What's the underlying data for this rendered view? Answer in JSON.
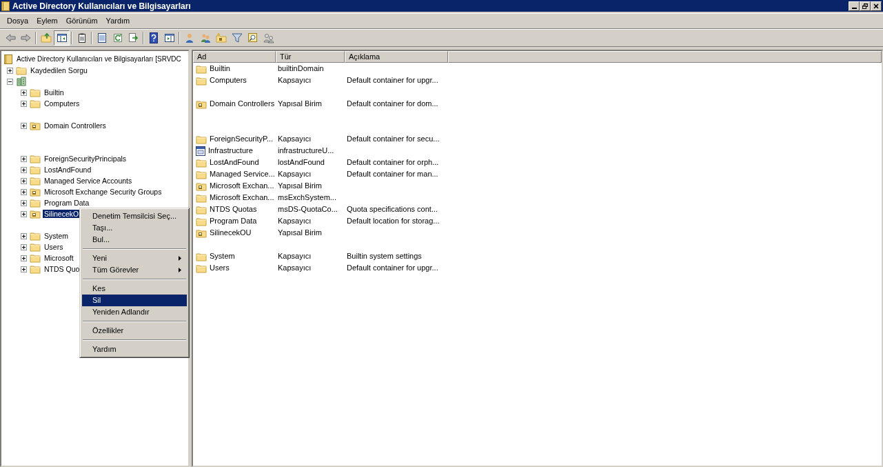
{
  "window": {
    "title": "Active Directory Kullanıcıları ve Bilgisayarları"
  },
  "menu": [
    "Dosya",
    "Eylem",
    "Görünüm",
    "Yardım"
  ],
  "toolbar": [
    {
      "pressed": false
    },
    {
      "pressed": false
    },
    {
      "pressed": false
    },
    {
      "pressed": true
    },
    {
      "pressed": false
    },
    {
      "pressed": false
    },
    {
      "pressed": false
    },
    {
      "pressed": false
    },
    {
      "pressed": false
    },
    {
      "pressed": false
    },
    {
      "pressed": false
    },
    {
      "pressed": false
    },
    {
      "pressed": false
    },
    {
      "pressed": false
    },
    {
      "pressed": false
    },
    {
      "pressed": false
    }
  ],
  "tree": {
    "label": "Active Directory Kullanıcıları ve Bilgisayarları [SRVDC",
    "kind": "root",
    "children": [
      {
        "label": "Kaydedilen Sorgu",
        "kind": "folder",
        "expanded": false,
        "selected": false
      },
      {
        "kind": "domain",
        "expanded": true,
        "children": [
          {
            "label": "Builtin",
            "kind": "folder",
            "expanded": false,
            "selected": false
          },
          {
            "label": "Computers",
            "kind": "folder",
            "expanded": false,
            "selected": false
          },
          {
            "kind": "blank"
          },
          {
            "label": "Domain Controllers",
            "kind": "ou",
            "expanded": false,
            "selected": false
          },
          {
            "kind": "blank"
          },
          {
            "kind": "blank"
          },
          {
            "label": "ForeignSecurityPrincipals",
            "kind": "folder",
            "expanded": false,
            "selected": false
          },
          {
            "label": "LostAndFound",
            "kind": "folder",
            "expanded": false,
            "selected": false
          },
          {
            "label": "Managed Service Accounts",
            "kind": "folder",
            "expanded": false,
            "selected": false
          },
          {
            "label": "Microsoft Exchange Security Groups",
            "kind": "ou",
            "expanded": false,
            "selected": false
          },
          {
            "label": "Program Data",
            "kind": "folder",
            "expanded": false,
            "selected": false
          },
          {
            "label": "SilinecekO",
            "kind": "ou",
            "expanded": false,
            "selected": true
          },
          {
            "kind": "blank"
          },
          {
            "label": "System",
            "kind": "folder",
            "expanded": false,
            "selected": false
          },
          {
            "label": "Users",
            "kind": "folder",
            "expanded": false,
            "selected": false
          },
          {
            "label": "Microsoft",
            "kind": "folder",
            "expanded": false,
            "selected": false
          },
          {
            "label": "NTDS Quo",
            "kind": "folder",
            "expanded": false,
            "selected": false
          }
        ]
      }
    ]
  },
  "list": {
    "columns": [
      "Ad",
      "Tür",
      "Açıklama"
    ],
    "rows": [
      {
        "kind": "folder",
        "name": "Builtin",
        "type": "builtinDomain"
      },
      {
        "kind": "folder",
        "name": "Computers",
        "type": "Kapsayıcı",
        "description": "Default container for upgr..."
      },
      {
        "kind": "blank"
      },
      {
        "kind": "ou",
        "name": "Domain Controllers",
        "type": "Yapısal Birim",
        "description": "Default container for dom..."
      },
      {
        "kind": "blank"
      },
      {
        "kind": "blank"
      },
      {
        "kind": "folder",
        "name": "ForeignSecurityP...",
        "type": "Kapsayıcı",
        "description": "Default container for secu..."
      },
      {
        "kind": "infra",
        "name": "Infrastructure",
        "type": "infrastructureU..."
      },
      {
        "kind": "folder",
        "name": "LostAndFound",
        "type": "lostAndFound",
        "description": "Default container for orph..."
      },
      {
        "kind": "folder",
        "name": "Managed Service...",
        "type": "Kapsayıcı",
        "description": "Default container for man..."
      },
      {
        "kind": "ou",
        "name": "Microsoft Exchan...",
        "type": "Yapısal Birim"
      },
      {
        "kind": "folder",
        "name": "Microsoft Exchan...",
        "type": "msExchSystem..."
      },
      {
        "kind": "folder",
        "name": "NTDS Quotas",
        "type": "msDS-QuotaCo...",
        "description": "Quota specifications cont..."
      },
      {
        "kind": "folder",
        "name": "Program Data",
        "type": "Kapsayıcı",
        "description": "Default location for storag..."
      },
      {
        "kind": "ou",
        "name": "SilinecekOU",
        "type": "Yapısal Birim"
      },
      {
        "kind": "blank"
      },
      {
        "kind": "folder",
        "name": "System",
        "type": "Kapsayıcı",
        "description": "Builtin system settings"
      },
      {
        "kind": "folder",
        "name": "Users",
        "type": "Kapsayıcı",
        "description": "Default container for upgr..."
      }
    ]
  },
  "context_menu": [
    {
      "kind": "item",
      "label": "Denetim Temsilcisi Seç...",
      "selected": false
    },
    {
      "kind": "item",
      "label": "Taşı...",
      "selected": false
    },
    {
      "kind": "item",
      "label": "Bul...",
      "selected": false
    },
    {
      "kind": "separator"
    },
    {
      "kind": "submenu",
      "label": "Yeni",
      "selected": false
    },
    {
      "kind": "submenu",
      "label": "Tüm Görevler",
      "selected": false
    },
    {
      "kind": "separator"
    },
    {
      "kind": "item",
      "label": "Kes",
      "selected": false
    },
    {
      "kind": "item",
      "label": "Sil",
      "selected": true
    },
    {
      "kind": "item",
      "label": "Yeniden Adlandır",
      "selected": false
    },
    {
      "kind": "separator"
    },
    {
      "kind": "item",
      "label": "Özellikler",
      "selected": false
    },
    {
      "kind": "separator"
    },
    {
      "kind": "item",
      "label": "Yardım",
      "selected": false
    }
  ]
}
